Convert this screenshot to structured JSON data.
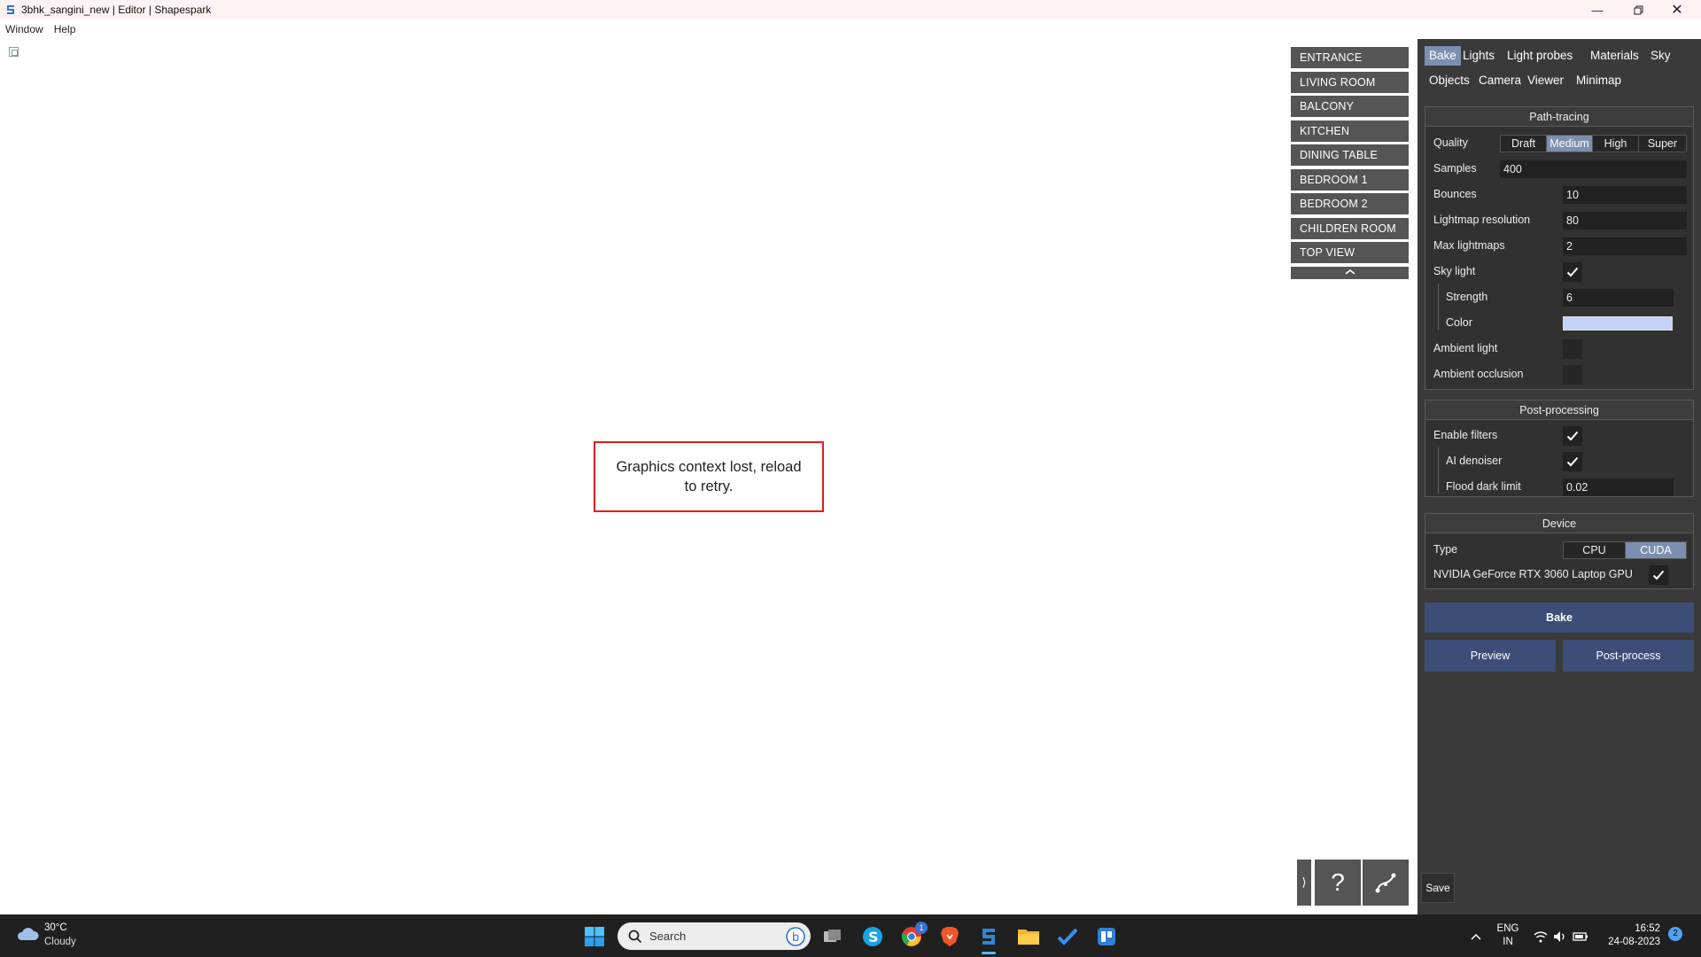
{
  "window": {
    "title": "3bhk_sangini_new | Editor | Shapespark",
    "controls": [
      "minimize-icon",
      "restore-icon",
      "close-icon"
    ]
  },
  "menu": {
    "items": [
      "Window",
      "Help"
    ]
  },
  "views": {
    "items": [
      "ENTRANCE",
      "LIVING ROOM",
      "BALCONY",
      "KITCHEN",
      "DINING TABLE",
      "BEDROOM 1",
      "BEDROOM 2",
      "CHILDREN ROOM",
      "TOP VIEW"
    ],
    "collapse_icon": "chevron-up-icon"
  },
  "error": {
    "message": "Graphics context lost, reload to retry."
  },
  "tools": {
    "expand": "⟩",
    "help": "?",
    "path_icon": "path-icon"
  },
  "panel": {
    "tabs": [
      "Bake",
      "Lights",
      "Light probes",
      "Materials",
      "Sky",
      "Objects",
      "Camera",
      "Viewer",
      "Minimap"
    ],
    "active_tab": "Bake",
    "path_tracing": {
      "header": "Path-tracing",
      "quality_label": "Quality",
      "quality_options": [
        "Draft",
        "Medium",
        "High",
        "Super"
      ],
      "quality_selected": "Medium",
      "samples_label": "Samples",
      "samples": "400",
      "bounces_label": "Bounces",
      "bounces": "10",
      "lightmap_resolution_label": "Lightmap resolution",
      "lightmap_resolution": "80",
      "max_lightmaps_label": "Max lightmaps",
      "max_lightmaps": "2",
      "sky_light_label": "Sky light",
      "sky_light": true,
      "strength_label": "Strength",
      "strength": "6",
      "color_label": "Color",
      "color": "#c5d3f8",
      "ambient_light_label": "Ambient light",
      "ambient_light": false,
      "ambient_occlusion_label": "Ambient occlusion",
      "ambient_occlusion": false
    },
    "post_processing": {
      "header": "Post-processing",
      "enable_filters_label": "Enable filters",
      "enable_filters": true,
      "ai_denoiser_label": "AI denoiser",
      "ai_denoiser": true,
      "flood_dark_limit_label": "Flood dark limit",
      "flood_dark_limit": "0.02"
    },
    "device": {
      "header": "Device",
      "type_label": "Type",
      "type_options": [
        "CPU",
        "CUDA"
      ],
      "type_selected": "CUDA",
      "gpu_label": "NVIDIA GeForce RTX 3060 Laptop GPU",
      "gpu_enabled": true
    },
    "buttons": {
      "bake": "Bake",
      "preview": "Preview",
      "post_process": "Post-process"
    },
    "save": "Save",
    "accent_color": "#7c8fb0",
    "button_color": "#3c4e77"
  },
  "taskbar": {
    "weather_temp": "30°C",
    "weather_condition": "Cloudy",
    "search_placeholder": "Search",
    "chrome_badge": "1",
    "apps": [
      "start-icon",
      "search-icon",
      "task-view-icon",
      "skype-icon",
      "chrome-icon",
      "brave-icon",
      "shapespark-icon",
      "file-explorer-icon",
      "todo-icon",
      "app-icon"
    ],
    "lang_top": "ENG",
    "lang_bottom": "IN",
    "time": "16:52",
    "date": "24-08-2023",
    "notification_count": "2"
  }
}
